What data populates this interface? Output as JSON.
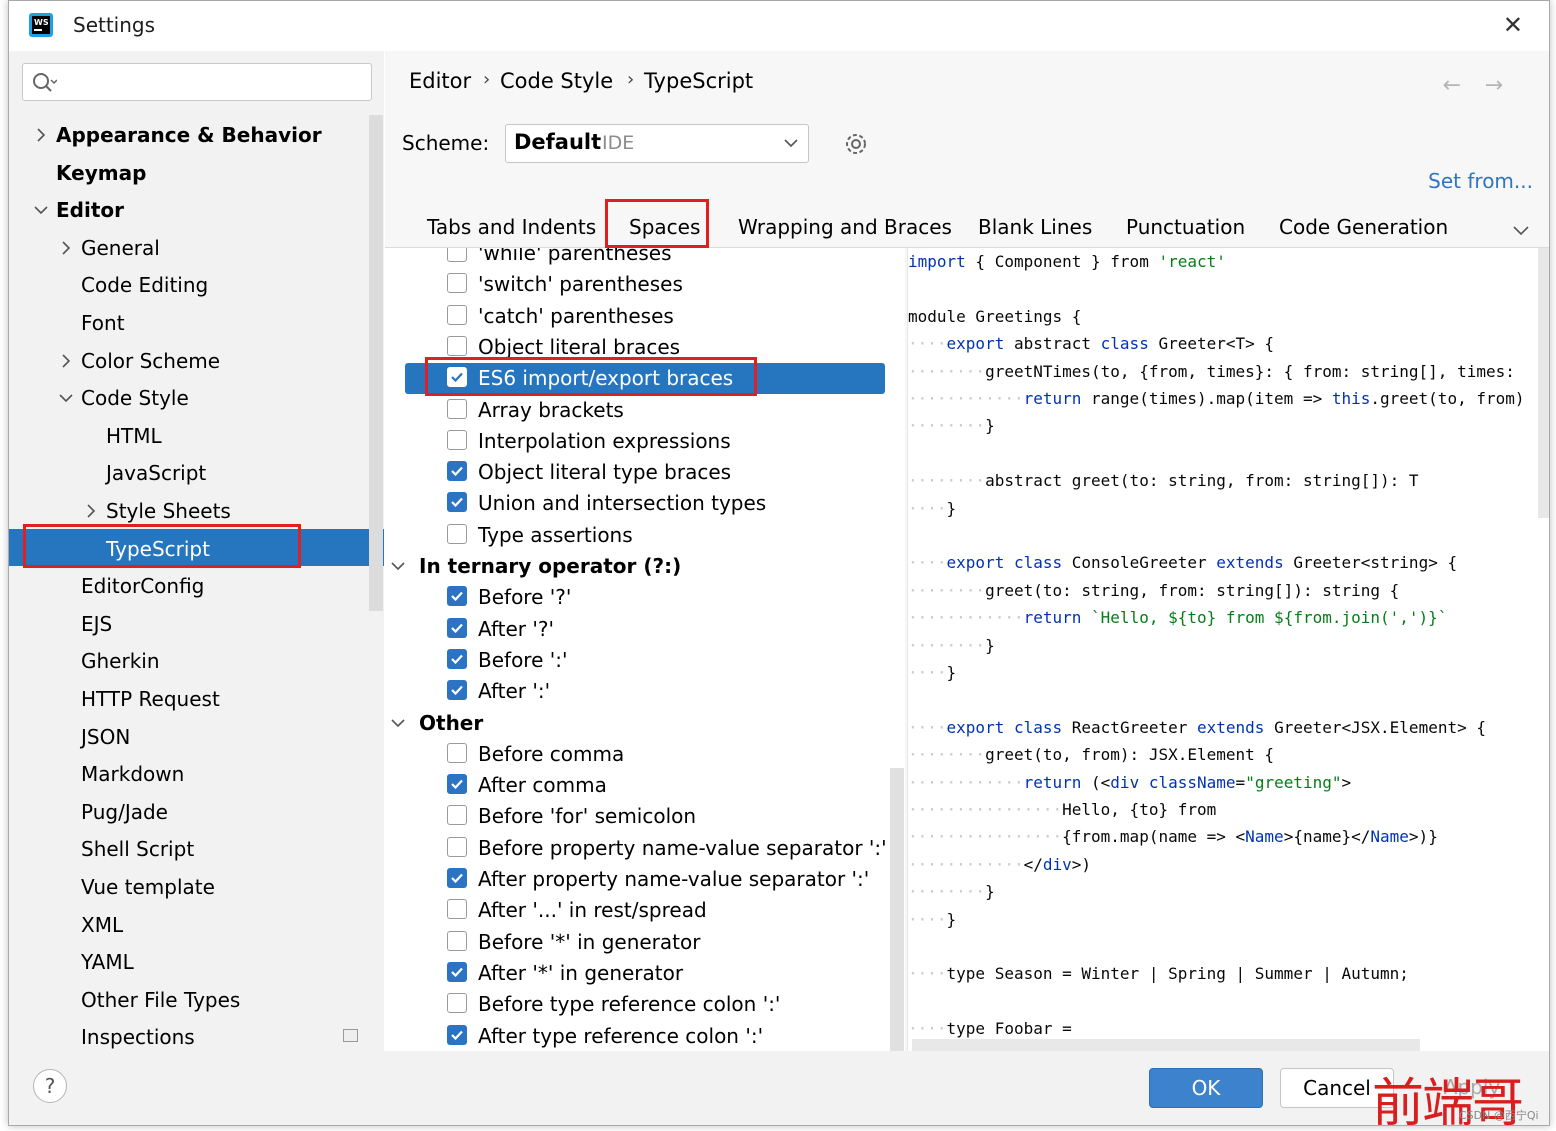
{
  "window": {
    "title": "Settings"
  },
  "search": {
    "placeholder": ""
  },
  "tree": [
    {
      "label": "Appearance & Behavior",
      "expandable": true,
      "expanded": false
    },
    {
      "label": "Keymap",
      "expandable": false
    },
    {
      "label": "Editor",
      "expandable": true,
      "expanded": true
    },
    {
      "label": "General",
      "expandable": true,
      "expanded": false
    },
    {
      "label": "Code Editing",
      "expandable": false
    },
    {
      "label": "Font",
      "expandable": false
    },
    {
      "label": "Color Scheme",
      "expandable": true,
      "expanded": false
    },
    {
      "label": "Code Style",
      "expandable": true,
      "expanded": true
    },
    {
      "label": "HTML",
      "expandable": false
    },
    {
      "label": "JavaScript",
      "expandable": false
    },
    {
      "label": "Style Sheets",
      "expandable": true,
      "expanded": false
    },
    {
      "label": "TypeScript",
      "expandable": false,
      "selected": true
    },
    {
      "label": "EditorConfig",
      "expandable": false
    },
    {
      "label": "EJS",
      "expandable": false
    },
    {
      "label": "Gherkin",
      "expandable": false
    },
    {
      "label": "HTTP Request",
      "expandable": false
    },
    {
      "label": "JSON",
      "expandable": false
    },
    {
      "label": "Markdown",
      "expandable": false
    },
    {
      "label": "Pug/Jade",
      "expandable": false
    },
    {
      "label": "Shell Script",
      "expandable": false
    },
    {
      "label": "Vue template",
      "expandable": false
    },
    {
      "label": "XML",
      "expandable": false
    },
    {
      "label": "YAML",
      "expandable": false
    },
    {
      "label": "Other File Types",
      "expandable": false
    },
    {
      "label": "Inspections",
      "expandable": false
    }
  ],
  "breadcrumb": [
    "Editor",
    "Code Style",
    "TypeScript"
  ],
  "scheme": {
    "label": "Scheme:",
    "value": "Default",
    "suffix": "IDE"
  },
  "set_from": "Set from...",
  "tabs": [
    "Tabs and Indents",
    "Spaces",
    "Wrapping and Braces",
    "Blank Lines",
    "Punctuation",
    "Code Generation"
  ],
  "active_tab": "Spaces",
  "options": [
    {
      "kind": "option",
      "label": "'while' parentheses",
      "checked": false
    },
    {
      "kind": "option",
      "label": "'switch' parentheses",
      "checked": false
    },
    {
      "kind": "option",
      "label": "'catch' parentheses",
      "checked": false
    },
    {
      "kind": "option",
      "label": "Object literal braces",
      "checked": false
    },
    {
      "kind": "option",
      "label": "ES6 import/export braces",
      "checked": true,
      "selected": true
    },
    {
      "kind": "option",
      "label": "Array brackets",
      "checked": false
    },
    {
      "kind": "option",
      "label": "Interpolation expressions",
      "checked": false
    },
    {
      "kind": "option",
      "label": "Object literal type braces",
      "checked": true
    },
    {
      "kind": "option",
      "label": "Union and intersection types",
      "checked": true
    },
    {
      "kind": "option",
      "label": "Type assertions",
      "checked": false
    },
    {
      "kind": "group",
      "label": "In ternary operator (?:)"
    },
    {
      "kind": "option",
      "label": "Before '?'",
      "checked": true
    },
    {
      "kind": "option",
      "label": "After '?'",
      "checked": true
    },
    {
      "kind": "option",
      "label": "Before ':'",
      "checked": true
    },
    {
      "kind": "option",
      "label": "After ':'",
      "checked": true
    },
    {
      "kind": "group",
      "label": "Other"
    },
    {
      "kind": "option",
      "label": "Before comma",
      "checked": false
    },
    {
      "kind": "option",
      "label": "After comma",
      "checked": true
    },
    {
      "kind": "option",
      "label": "Before 'for' semicolon",
      "checked": false
    },
    {
      "kind": "option",
      "label": "Before property name-value separator ':'",
      "checked": false
    },
    {
      "kind": "option",
      "label": "After property name-value separator ':'",
      "checked": true
    },
    {
      "kind": "option",
      "label": "After '...' in rest/spread",
      "checked": false
    },
    {
      "kind": "option",
      "label": "Before '*' in generator",
      "checked": false
    },
    {
      "kind": "option",
      "label": "After '*' in generator",
      "checked": true
    },
    {
      "kind": "option",
      "label": "Before type reference colon ':'",
      "checked": false
    },
    {
      "kind": "option",
      "label": "After type reference colon ':'",
      "checked": true
    }
  ],
  "code_lines": [
    "import { Component } from 'react'",
    "",
    "module Greetings {",
    "    export abstract class Greeter<T> {",
    "        greetNTimes(to, {from, times}: { from: string[], times:",
    "            return range(times).map(item => this.greet(to, from)",
    "        }",
    "",
    "        abstract greet(to: string, from: string[]): T",
    "    }",
    "",
    "    export class ConsoleGreeter extends Greeter<string> {",
    "        greet(to: string, from: string[]): string {",
    "            return `Hello, ${to} from ${from.join(',')}`",
    "        }",
    "    }",
    "",
    "    export class ReactGreeter extends Greeter<JSX.Element> {",
    "        greet(to, from): JSX.Element {",
    "            return (<div className=\"greeting\">",
    "                Hello, {to} from",
    "                {from.map(name => <Name>{name}</Name>)}",
    "            </div>)",
    "        }",
    "    }",
    "",
    "    type Season = Winter | Spring | Summer | Autumn;",
    "",
    "    type Foobar ="
  ],
  "buttons": {
    "ok": "OK",
    "cancel": "Cancel",
    "apply": "Apply",
    "help": "?"
  },
  "watermark": {
    "text": "前端哥",
    "small": "CSDN @西宁Qi"
  },
  "colors": {
    "accent": "#2675bf",
    "highlight": "#e02020",
    "keyword": "#0033b3",
    "string": "#067d17"
  }
}
